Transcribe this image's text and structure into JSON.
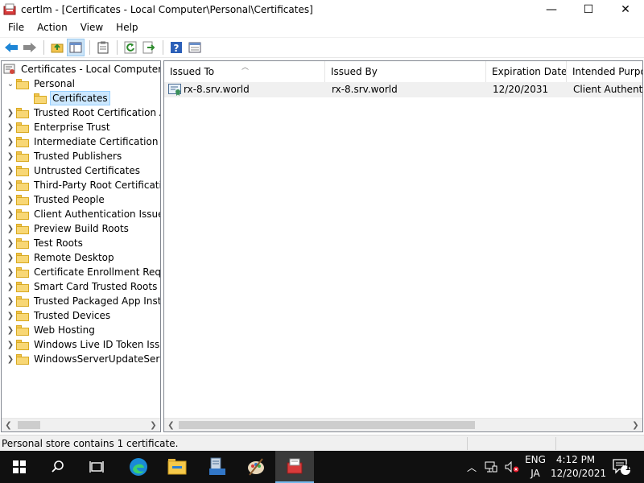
{
  "window": {
    "title": "certlm - [Certificates - Local Computer\\Personal\\Certificates]",
    "controls": {
      "minimize": "—",
      "maximize": "☐",
      "close": "✕"
    }
  },
  "menu": [
    "File",
    "Action",
    "View",
    "Help"
  ],
  "toolbar": {
    "buttons": [
      "back-arrow-icon",
      "forward-arrow-icon",
      "up-folder-icon",
      "show-hide-tree-icon",
      "clipboard-icon",
      "refresh-icon",
      "export-list-icon",
      "help-icon",
      "properties-icon"
    ]
  },
  "tree": {
    "root": "Certificates - Local Computer",
    "personal": "Personal",
    "personal_child": "Certificates",
    "stores": [
      "Trusted Root Certification Authorities",
      "Enterprise Trust",
      "Intermediate Certification Authorities",
      "Trusted Publishers",
      "Untrusted Certificates",
      "Third-Party Root Certification Authorities",
      "Trusted People",
      "Client Authentication Issuers",
      "Preview Build Roots",
      "Test Roots",
      "Remote Desktop",
      "Certificate Enrollment Requests",
      "Smart Card Trusted Roots",
      "Trusted Packaged App Installation Authorities",
      "Trusted Devices",
      "Web Hosting",
      "Windows Live ID Token Issuer",
      "WindowsServerUpdateServices"
    ]
  },
  "list": {
    "columns": [
      "Issued To",
      "Issued By",
      "Expiration Date",
      "Intended Purposes"
    ],
    "rows": [
      {
        "issued_to": "rx-8.srv.world",
        "issued_by": "rx-8.srv.world",
        "expiration": "12/20/2031",
        "purposes": "Client Authentication"
      }
    ]
  },
  "status": {
    "text": "Personal store contains 1 certificate."
  },
  "taskbar": {
    "lang_top": "ENG",
    "lang_bottom": "JA",
    "time": "4:12 PM",
    "date": "12/20/2021",
    "notification_count": "1"
  },
  "colors": {
    "accent": "#0078d7",
    "folder": "#f8d775",
    "selection": "#cce8ff"
  }
}
